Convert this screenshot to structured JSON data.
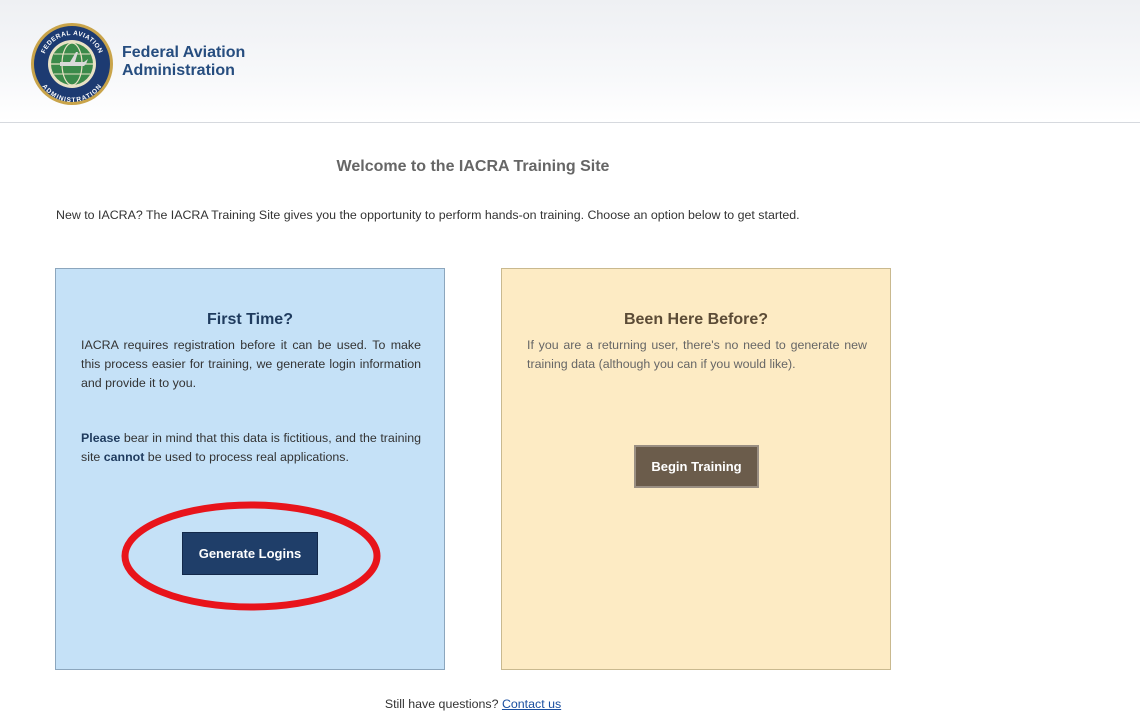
{
  "header": {
    "agency_line1": "Federal Aviation",
    "agency_line2": "Administration",
    "seal_text_top": "FEDERAL AVIATION",
    "seal_text_bottom": "ADMINISTRATION",
    "seal_icon": "faa-seal-icon"
  },
  "main": {
    "title": "Welcome to the IACRA Training Site",
    "intro": "New to IACRA? The IACRA Training Site gives you the opportunity to perform hands-on training. Choose an option below to get started."
  },
  "first_time": {
    "title": "First Time?",
    "paragraph1": "IACRA requires registration before it can be used. To make this process easier for training, we generate login information and provide it to you.",
    "p2_bold1": "Please",
    "p2_text1": " bear in mind that this data is fictitious, and the training site ",
    "p2_bold2": "cannot",
    "p2_text2": " be used to process real applications.",
    "button": "Generate Logins"
  },
  "been_here": {
    "title": "Been Here Before?",
    "paragraph1": "If you are a returning user, there's no need to generate new training data (although you can if you would like).",
    "button": "Begin Training"
  },
  "footer": {
    "question": "Still have questions? ",
    "link": "Contact us"
  },
  "colors": {
    "brand_blue": "#264d7f",
    "panel_blue": "#c5e1f7",
    "panel_yellow": "#fdebc4",
    "generate_button": "#1f3e69",
    "begin_button": "#6b5c4b",
    "annotation_red": "#e8141b"
  }
}
